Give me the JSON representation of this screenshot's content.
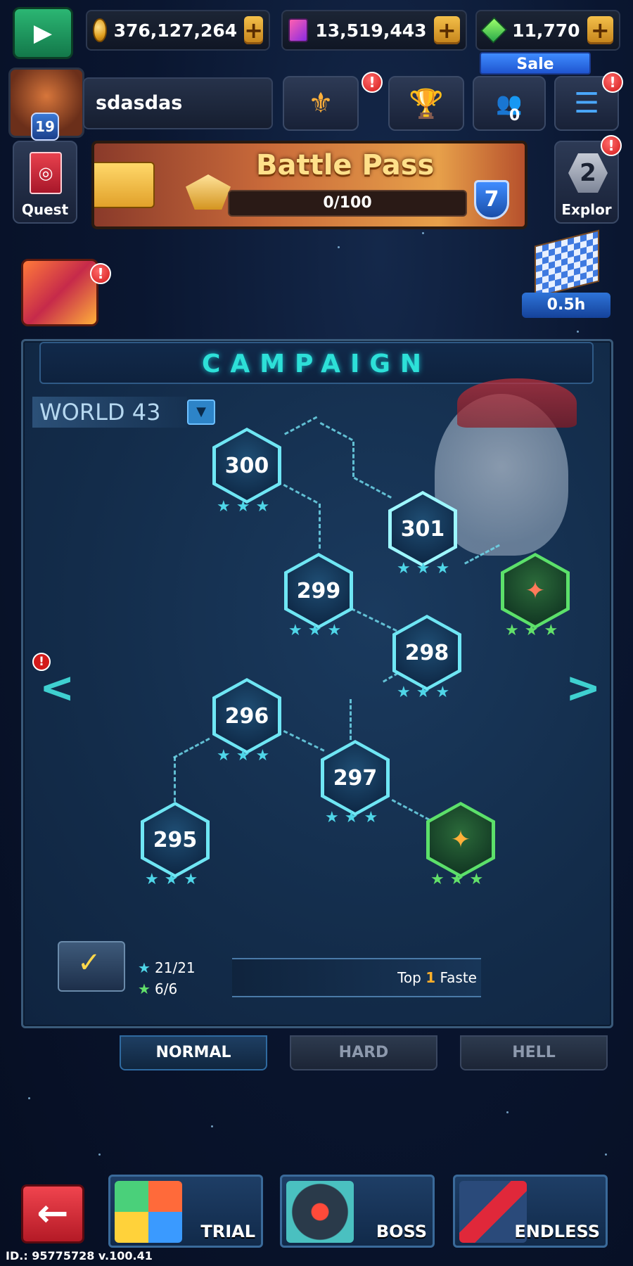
{
  "currencies": {
    "coins": "376,127,264",
    "cards": "13,519,443",
    "gems": "11,770",
    "sale_label": "Sale"
  },
  "profile": {
    "name": "sdasdas",
    "level": "19"
  },
  "top_buttons": {
    "rank_alert": "!",
    "trophy_alert": "",
    "friends_count": "0",
    "menu_alert": "!"
  },
  "battle_pass": {
    "title": "Battle Pass",
    "progress": "0/100",
    "level": "7"
  },
  "quest": {
    "label": "Quest"
  },
  "explore": {
    "label": "Explor",
    "count": "2",
    "alert": "!"
  },
  "gift": {
    "alert": "!"
  },
  "event_timer": "0.5h",
  "campaign": {
    "title": "CAMPAIGN",
    "world": "WORLD  43",
    "stages": {
      "s295": "295",
      "s296": "296",
      "s297": "297",
      "s298": "298",
      "s299": "299",
      "s300": "300",
      "s301": "301"
    },
    "nav_prev": "<",
    "nav_next": ">",
    "left_alert": "!",
    "stats": {
      "stars_blue": "21/21",
      "stars_green": "6/6"
    },
    "rank_text_prefix": "Top",
    "rank_num": "1",
    "rank_text_suffix": "Faste"
  },
  "difficulty_tabs": [
    "NORMAL",
    "HARD",
    "HELL"
  ],
  "modes": {
    "trial": "TRIAL",
    "boss": "BOSS",
    "endless": "ENDLESS"
  },
  "footer_id": "ID.: 95775728 v.100.41",
  "colors": {
    "accent_cyan": "#2de0d8",
    "boss_green": "#5ce06a",
    "gold": "#ffb02a",
    "alert_red": "#d31a1a"
  }
}
